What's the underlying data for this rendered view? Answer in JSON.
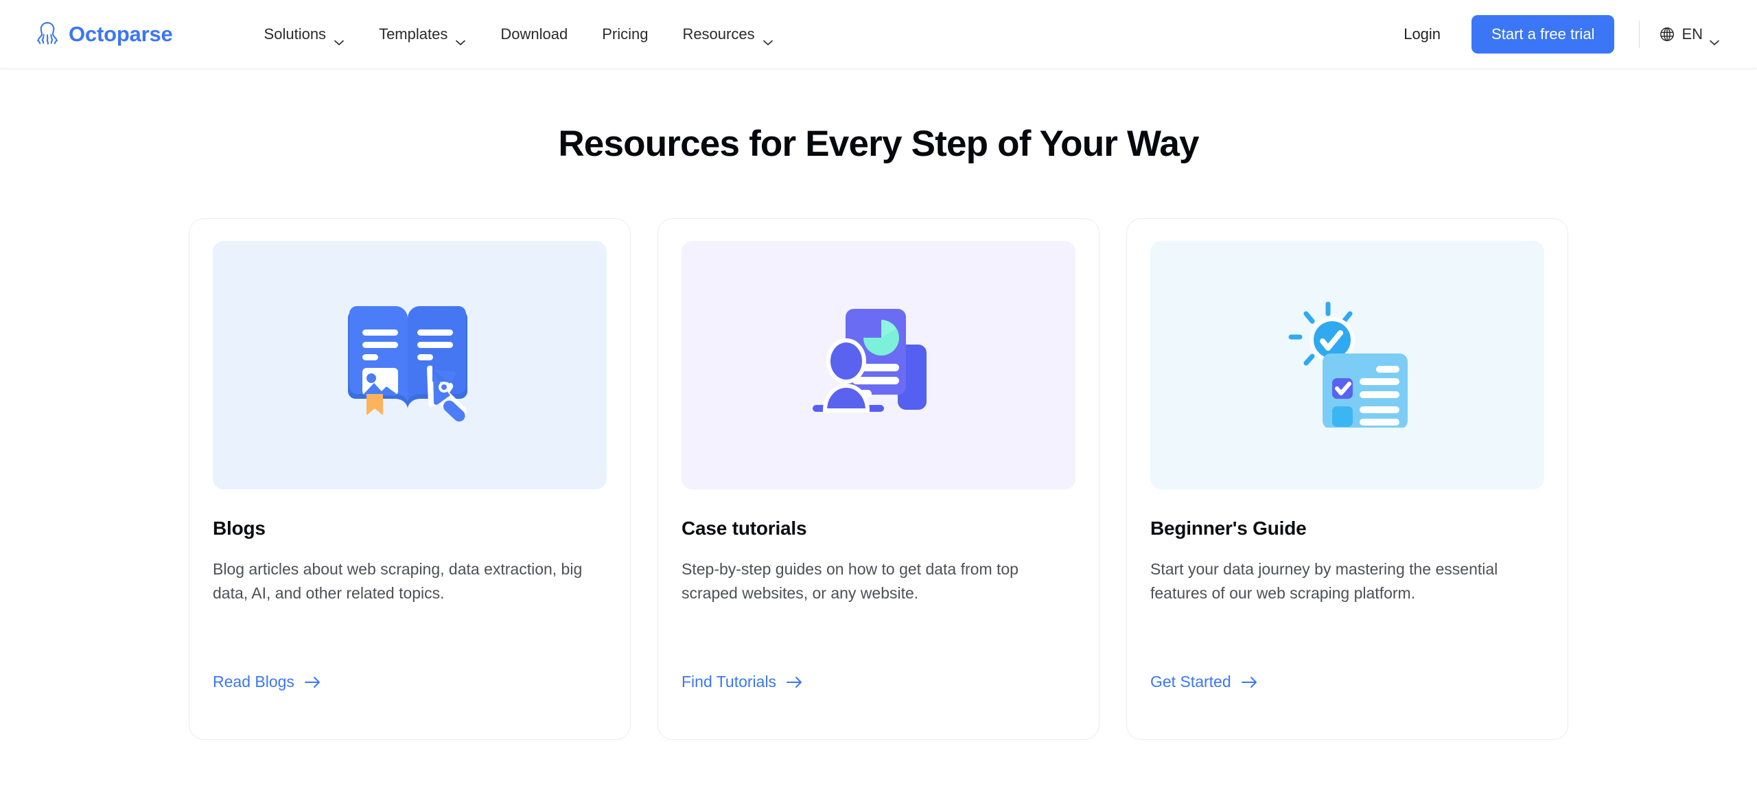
{
  "header": {
    "brand": {
      "name": "Octoparse",
      "icon": "octopus-logo-icon",
      "color": "#3b76f6"
    },
    "nav": [
      {
        "label": "Solutions",
        "has_dropdown": true
      },
      {
        "label": "Templates",
        "has_dropdown": true
      },
      {
        "label": "Download",
        "has_dropdown": false
      },
      {
        "label": "Pricing",
        "has_dropdown": false
      },
      {
        "label": "Resources",
        "has_dropdown": true
      }
    ],
    "login_label": "Login",
    "trial_label": "Start a free trial",
    "trial_color": "#3b76f6",
    "language": {
      "label": "EN",
      "icon": "globe-icon",
      "chevron": "chevron-down-icon"
    }
  },
  "main": {
    "title": "Resources for Every Step of Your Way",
    "cards": [
      {
        "title": "Blogs",
        "description": "Blog articles about web scraping, data extraction, big data, AI, and other related topics.",
        "link_label": "Read Blogs",
        "illustration": "open-book-with-pen-icon",
        "media_bg": "#eaf2fe"
      },
      {
        "title": "Case tutorials",
        "description": "Step-by-step guides on how to get data from top scraped websites, or any website.",
        "link_label": "Find Tutorials",
        "illustration": "person-with-report-icon",
        "media_bg": "#f3f2fe"
      },
      {
        "title": "Beginner's Guide",
        "description": "Start your data journey by mastering the essential features of our web scraping platform.",
        "link_label": "Get Started",
        "illustration": "lightbulb-checklist-icon",
        "media_bg": "#eef8fd"
      }
    ]
  }
}
